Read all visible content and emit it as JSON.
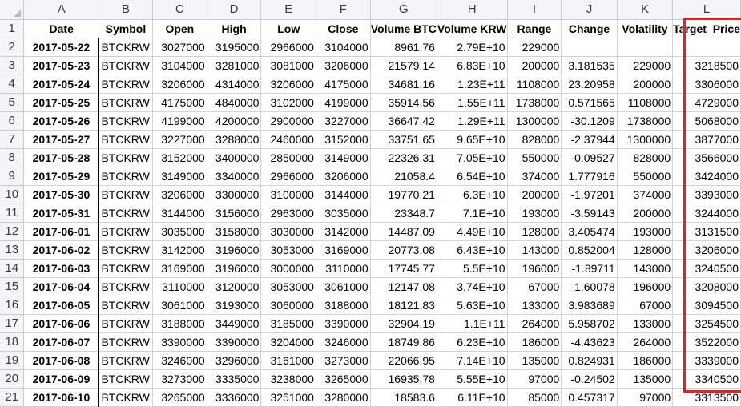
{
  "columns": [
    "A",
    "B",
    "C",
    "D",
    "E",
    "F",
    "G",
    "H",
    "I",
    "J",
    "K",
    "L"
  ],
  "headers": [
    "Date",
    "Symbol",
    "Open",
    "High",
    "Low",
    "Close",
    "Volume BTC",
    "Volume KRW",
    "Range",
    "Change",
    "Volatility",
    "Target_Price"
  ],
  "rows": [
    {
      "n": "1"
    },
    {
      "n": "2",
      "c": [
        "2017-05-22",
        "BTCKRW",
        "3027000",
        "3195000",
        "2966000",
        "3104000",
        "8961.76",
        "2.79E+10",
        "229000",
        "",
        "",
        ""
      ]
    },
    {
      "n": "3",
      "c": [
        "2017-05-23",
        "BTCKRW",
        "3104000",
        "3281000",
        "3081000",
        "3206000",
        "21579.14",
        "6.83E+10",
        "200000",
        "3.181535",
        "229000",
        "3218500"
      ]
    },
    {
      "n": "4",
      "c": [
        "2017-05-24",
        "BTCKRW",
        "3206000",
        "4314000",
        "3206000",
        "4175000",
        "34681.16",
        "1.23E+11",
        "1108000",
        "23.20958",
        "200000",
        "3306000"
      ]
    },
    {
      "n": "5",
      "c": [
        "2017-05-25",
        "BTCKRW",
        "4175000",
        "4840000",
        "3102000",
        "4199000",
        "35914.56",
        "1.55E+11",
        "1738000",
        "0.571565",
        "1108000",
        "4729000"
      ]
    },
    {
      "n": "6",
      "c": [
        "2017-05-26",
        "BTCKRW",
        "4199000",
        "4200000",
        "2900000",
        "3227000",
        "36647.42",
        "1.29E+11",
        "1300000",
        "-30.1209",
        "1738000",
        "5068000"
      ]
    },
    {
      "n": "7",
      "c": [
        "2017-05-27",
        "BTCKRW",
        "3227000",
        "3288000",
        "2460000",
        "3152000",
        "33751.65",
        "9.65E+10",
        "828000",
        "-2.37944",
        "1300000",
        "3877000"
      ]
    },
    {
      "n": "8",
      "c": [
        "2017-05-28",
        "BTCKRW",
        "3152000",
        "3400000",
        "2850000",
        "3149000",
        "22326.31",
        "7.05E+10",
        "550000",
        "-0.09527",
        "828000",
        "3566000"
      ]
    },
    {
      "n": "9",
      "c": [
        "2017-05-29",
        "BTCKRW",
        "3149000",
        "3340000",
        "2966000",
        "3206000",
        "21058.4",
        "6.54E+10",
        "374000",
        "1.777916",
        "550000",
        "3424000"
      ]
    },
    {
      "n": "10",
      "c": [
        "2017-05-30",
        "BTCKRW",
        "3206000",
        "3300000",
        "3100000",
        "3144000",
        "19770.21",
        "6.3E+10",
        "200000",
        "-1.97201",
        "374000",
        "3393000"
      ]
    },
    {
      "n": "11",
      "c": [
        "2017-05-31",
        "BTCKRW",
        "3144000",
        "3156000",
        "2963000",
        "3035000",
        "23348.7",
        "7.1E+10",
        "193000",
        "-3.59143",
        "200000",
        "3244000"
      ]
    },
    {
      "n": "12",
      "c": [
        "2017-06-01",
        "BTCKRW",
        "3035000",
        "3158000",
        "3030000",
        "3142000",
        "14487.09",
        "4.49E+10",
        "128000",
        "3.405474",
        "193000",
        "3131500"
      ]
    },
    {
      "n": "13",
      "c": [
        "2017-06-02",
        "BTCKRW",
        "3142000",
        "3196000",
        "3053000",
        "3169000",
        "20773.08",
        "6.43E+10",
        "143000",
        "0.852004",
        "128000",
        "3206000"
      ]
    },
    {
      "n": "14",
      "c": [
        "2017-06-03",
        "BTCKRW",
        "3169000",
        "3196000",
        "3000000",
        "3110000",
        "17745.77",
        "5.5E+10",
        "196000",
        "-1.89711",
        "143000",
        "3240500"
      ]
    },
    {
      "n": "15",
      "c": [
        "2017-06-04",
        "BTCKRW",
        "3110000",
        "3120000",
        "3053000",
        "3061000",
        "12147.08",
        "3.74E+10",
        "67000",
        "-1.60078",
        "196000",
        "3208000"
      ]
    },
    {
      "n": "16",
      "c": [
        "2017-06-05",
        "BTCKRW",
        "3061000",
        "3193000",
        "3060000",
        "3188000",
        "18121.83",
        "5.63E+10",
        "133000",
        "3.983689",
        "67000",
        "3094500"
      ]
    },
    {
      "n": "17",
      "c": [
        "2017-06-06",
        "BTCKRW",
        "3188000",
        "3449000",
        "3185000",
        "3390000",
        "32904.19",
        "1.1E+11",
        "264000",
        "5.958702",
        "133000",
        "3254500"
      ]
    },
    {
      "n": "18",
      "c": [
        "2017-06-07",
        "BTCKRW",
        "3390000",
        "3390000",
        "3204000",
        "3246000",
        "18749.86",
        "6.23E+10",
        "186000",
        "-4.43623",
        "264000",
        "3522000"
      ]
    },
    {
      "n": "19",
      "c": [
        "2017-06-08",
        "BTCKRW",
        "3246000",
        "3296000",
        "3161000",
        "3273000",
        "22066.95",
        "7.14E+10",
        "135000",
        "0.824931",
        "186000",
        "3339000"
      ]
    },
    {
      "n": "20",
      "c": [
        "2017-06-09",
        "BTCKRW",
        "3273000",
        "3335000",
        "3238000",
        "3265000",
        "16935.78",
        "5.55E+10",
        "97000",
        "-0.24502",
        "135000",
        "3340500"
      ]
    },
    {
      "n": "21",
      "c": [
        "2017-06-10",
        "BTCKRW",
        "3265000",
        "3336000",
        "3251000",
        "3280000",
        "18583.6",
        "6.11E+10",
        "85000",
        "0.457317",
        "97000",
        "3313500"
      ]
    }
  ],
  "selection_color": "#e02424"
}
